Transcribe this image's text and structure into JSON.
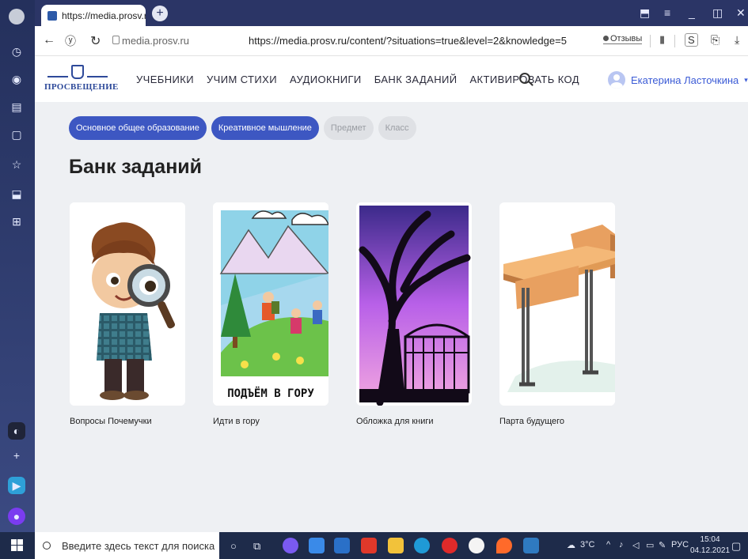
{
  "browser": {
    "tab_title": "https://media.prosv.ru/c",
    "tab_close": "×",
    "new_tab": "+",
    "domain": "media.prosv.ru",
    "url": "https://media.prosv.ru/content/?situations=true&level=2&knowledge=5",
    "reviews_label": "Отзывы"
  },
  "site": {
    "logo_text": "ПРОСВЕЩЕНИЕ",
    "nav": [
      "УЧЕБНИКИ",
      "УЧИМ СТИХИ",
      "АУДИОКНИГИ",
      "БАНК ЗАДАНИЙ",
      "АКТИВИРОВАТЬ КОД"
    ],
    "user_name": "Екатерина Ласточкина",
    "user_caret": "▾"
  },
  "filters": [
    {
      "label": "Основное общее образование",
      "active": true
    },
    {
      "label": "Креативное мышление",
      "active": true
    },
    {
      "label": "Предмет",
      "active": false
    },
    {
      "label": "Класс",
      "active": false
    }
  ],
  "page_title": "Банк заданий",
  "cards": [
    {
      "caption": "Вопросы Почемучки"
    },
    {
      "caption": "Идти в гору",
      "image_text": "ПОДЪЁМ В ГОРУ"
    },
    {
      "caption": "Обложка для книги"
    },
    {
      "caption": "Парта будущего"
    }
  ],
  "taskbar": {
    "search_placeholder": "Введите здесь текст для поиска",
    "temperature": "3°C",
    "language": "РУС",
    "time": "15:04",
    "date": "04.12.2021"
  },
  "colors": {
    "accent": "#3d57c2",
    "sidebar": "#2d3a6b",
    "content_bg": "#eef0f3",
    "taskbar": "#1e2b4a"
  }
}
